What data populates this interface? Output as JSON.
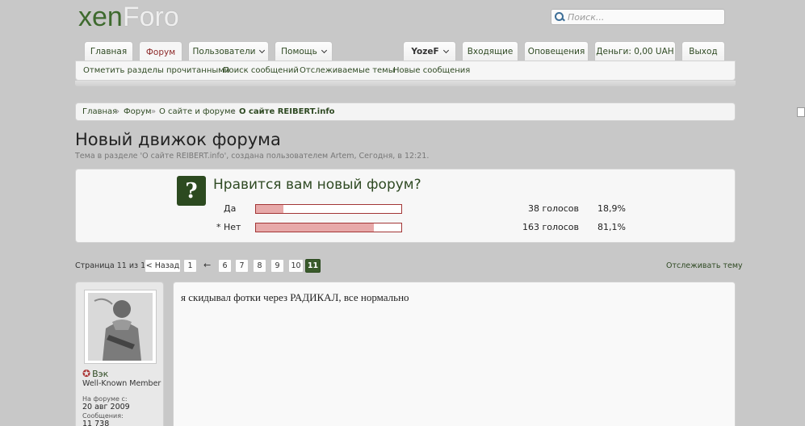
{
  "logo": {
    "part1": "xen",
    "part2": "Foro"
  },
  "search": {
    "placeholder": "Поиск..."
  },
  "nav": {
    "tabs": [
      {
        "label": "Главная"
      },
      {
        "label": "Форум"
      },
      {
        "label": "Пользователи"
      },
      {
        "label": "Помощь"
      }
    ],
    "user_tabs": [
      {
        "label": "YozeF"
      },
      {
        "label": "Входящие"
      },
      {
        "label": "Оповещения"
      },
      {
        "label": "Деньги: 0,00 UAH"
      },
      {
        "label": "Выход"
      }
    ],
    "sub": [
      "Отметить разделы прочитанными",
      "Поиск сообщений",
      "Отслеживаемые темы",
      "Новые сообщения"
    ]
  },
  "breadcrumb": {
    "items": [
      "Главная",
      "Форум",
      "О сайте и форуме",
      "О сайте REIBERT.info"
    ],
    "separator": "»"
  },
  "thread": {
    "title": "Новый движок форума",
    "subtitle": "Тема в разделе 'О сайте REIBERT.info', создана пользователем Artem, Сегодня, в 12:21."
  },
  "poll": {
    "icon": "?",
    "question": "Нравится вам новый форум?",
    "options": [
      {
        "label": "Да",
        "votes": "38 голосов",
        "percent": "18,9%",
        "share": 18.9
      },
      {
        "label": "* Нет",
        "votes": "163 голосов",
        "percent": "81,1%",
        "share": 81.1
      }
    ]
  },
  "pagination": {
    "label": "Страница 11 из 11",
    "prev": "< Назад",
    "pages": [
      "1",
      "6",
      "7",
      "8",
      "9",
      "10",
      "11"
    ],
    "gap": "←",
    "current": "11",
    "watch": "Отслеживать тему"
  },
  "post": {
    "author": "Вэк",
    "author_title": "Well-Known Member",
    "joined_label": "На форуме с:",
    "joined": "20 авг 2009",
    "messages_label": "Сообщения:",
    "messages": "11 738",
    "text": "я скидывал фотки через РАДИКАЛ, все нормально"
  }
}
